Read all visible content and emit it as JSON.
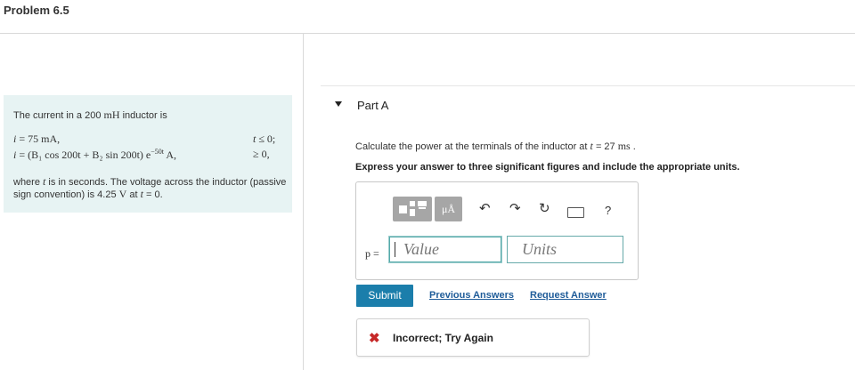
{
  "page": {
    "title": "Problem 6.5"
  },
  "problem": {
    "intro_text": "The current in a 200",
    "intro_unit": "mH",
    "intro_rest": " inductor is",
    "eq1_lhs": "i",
    "eq1_rhs": " = 75 mA,",
    "eq1_cond_var": "t",
    "eq1_cond": " ≤ 0;",
    "eq2_lhs": "i",
    "eq2_rhs": " = (B₁ cos 200t + B₂ sin 200t) e",
    "eq2_exp": "−50t",
    "eq2_unit": " A,",
    "eq2_cond": "≥ 0,",
    "where_text_1": "where ",
    "where_var": "t",
    "where_text_2": " is in seconds. The voltage across the inductor (passive sign convention) is 4.25 ",
    "where_unit": "V",
    "where_text_3": " at ",
    "where_var2": "t",
    "where_text_4": " = 0."
  },
  "part": {
    "label": "Part A",
    "question_prefix": "Calculate the power at the terminals of the inductor at ",
    "question_var": "t",
    "question_value": " = 27 ",
    "question_unit": "ms",
    "question_suffix": " .",
    "instruction": "Express your answer to three significant figures and include the appropriate units."
  },
  "toolbar": {
    "mu_label": "μÅ",
    "undo_glyph": "↶",
    "redo_glyph": "↷",
    "reset_glyph": "↻",
    "help_label": "?"
  },
  "answer": {
    "var_label": "p =",
    "value_placeholder": "Value",
    "units_placeholder": "Units"
  },
  "actions": {
    "submit_label": "Submit",
    "previous_answers_label": "Previous Answers",
    "request_answer_label": "Request Answer"
  },
  "feedback": {
    "icon_glyph": "✖",
    "text": "Incorrect; Try Again",
    "color": "#c62828"
  },
  "colors": {
    "problem_bg": "#e7f3f3",
    "submit_bg": "#1b7eab",
    "link": "#1f5c99"
  }
}
